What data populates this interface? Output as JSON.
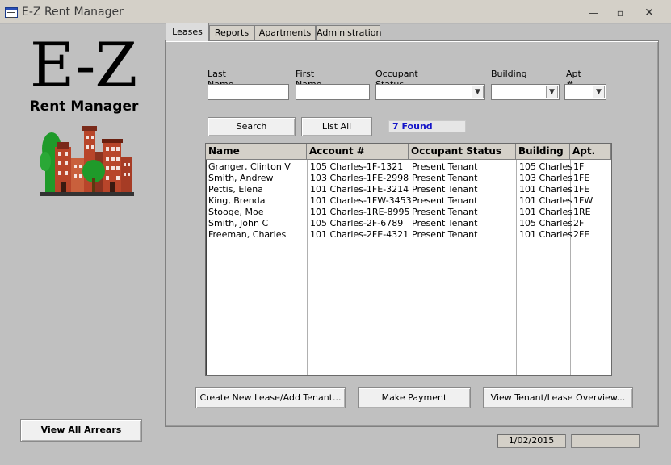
{
  "window": {
    "title": "E-Z Rent Manager",
    "minimize_glyph": "—",
    "maximize_glyph": "▫",
    "close_glyph": "✕"
  },
  "logo": {
    "main": "E-Z",
    "sub": "Rent Manager"
  },
  "tabs": [
    {
      "label": "Leases",
      "active": true
    },
    {
      "label": "Reports"
    },
    {
      "label": "Apartments"
    },
    {
      "label": "Administration"
    }
  ],
  "filters": {
    "last_name": {
      "label": "Last Name",
      "value": ""
    },
    "first_name": {
      "label": "First Name",
      "value": ""
    },
    "occupant_status": {
      "label": "Occupant Status",
      "value": ""
    },
    "building": {
      "label": "Building",
      "value": ""
    },
    "apt": {
      "label": "Apt #",
      "value": ""
    }
  },
  "actions": {
    "search": "Search",
    "list_all": "List All",
    "found": "7 Found"
  },
  "table": {
    "columns": [
      "Name",
      "Account #",
      "Occupant Status",
      "Building",
      "Apt."
    ],
    "rows": [
      [
        "Granger, Clinton V",
        "105 Charles-1F-1321",
        "Present Tenant",
        "105 Charles",
        "1F"
      ],
      [
        "Smith, Andrew",
        "103 Charles-1FE-2998",
        "Present Tenant",
        "103 Charles",
        "1FE"
      ],
      [
        "Pettis, Elena",
        "101 Charles-1FE-3214",
        "Present Tenant",
        "101 Charles",
        "1FE"
      ],
      [
        "King, Brenda",
        "101 Charles-1FW-3453",
        "Present Tenant",
        "101 Charles",
        "1FW"
      ],
      [
        "Stooge, Moe",
        "101 Charles-1RE-8995",
        "Present Tenant",
        "101 Charles",
        "1RE"
      ],
      [
        "Smith, John C",
        "105 Charles-2F-6789",
        "Present Tenant",
        "105 Charles",
        "2F"
      ],
      [
        "Freeman, Charles",
        "101 Charles-2FE-4321",
        "Present Tenant",
        "101 Charles",
        "2FE"
      ]
    ]
  },
  "bottom_buttons": {
    "create": "Create New Lease/Add Tenant...",
    "payment": "Make Payment",
    "overview": "View Tenant/Lease Overview..."
  },
  "arrears_button": "View All Arrears",
  "status": {
    "date": "1/02/2015"
  },
  "colors": {
    "found_text": "#1414c8",
    "brick": "#b8452a",
    "tree": "#1f9a2a"
  }
}
